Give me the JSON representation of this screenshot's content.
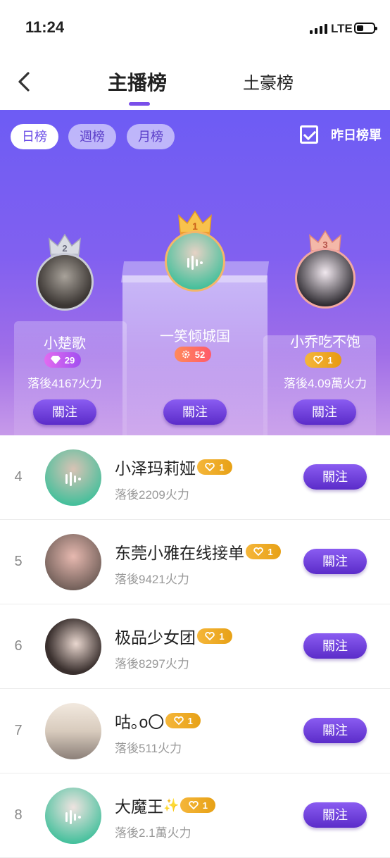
{
  "status": {
    "time": "11:24",
    "network": "LTE"
  },
  "nav": {
    "tabs": [
      "主播榜",
      "土豪榜"
    ]
  },
  "filters": {
    "periods": [
      "日榜",
      "週榜",
      "月榜"
    ],
    "yesterday_label": "昨日榜單"
  },
  "top3": [
    {
      "rank": "2",
      "name": "小楚歌",
      "badge_value": "29",
      "badge_type": "diamond",
      "behind": "落後4167火力",
      "follow": "關注"
    },
    {
      "rank": "1",
      "name": "一笑倾城国",
      "badge_value": "52",
      "badge_type": "gear",
      "behind": "",
      "follow": "關注"
    },
    {
      "rank": "3",
      "name": "小乔吃不饱",
      "badge_value": "1",
      "badge_type": "heart",
      "behind": "落後4.09萬火力",
      "follow": "關注"
    }
  ],
  "list": [
    {
      "rank": "4",
      "name": "小泽玛莉娅",
      "sparkle": "",
      "badge_value": "1",
      "behind": "落後2209火力",
      "follow": "關注",
      "live": true
    },
    {
      "rank": "5",
      "name": "东莞小雅在线接单",
      "sparkle": "",
      "badge_value": "1",
      "behind": "落後9421火力",
      "follow": "關注",
      "live": false
    },
    {
      "rank": "6",
      "name": "极品少女团",
      "sparkle": "",
      "badge_value": "1",
      "behind": "落後8297火力",
      "follow": "關注",
      "live": false
    },
    {
      "rank": "7",
      "name": "咕｡o〇",
      "sparkle": "",
      "badge_value": "1",
      "behind": "落後511火力",
      "follow": "關注",
      "live": false
    },
    {
      "rank": "8",
      "name": "大魔王",
      "sparkle": "✨",
      "badge_value": "1",
      "behind": "落後2.1萬火力",
      "follow": "關注",
      "live": true
    }
  ],
  "colors": {
    "accent": "#7a4fea",
    "button_top": "#8a5cf1",
    "button_bottom": "#5b2cc9",
    "badge_gold": "#f5b63a"
  }
}
